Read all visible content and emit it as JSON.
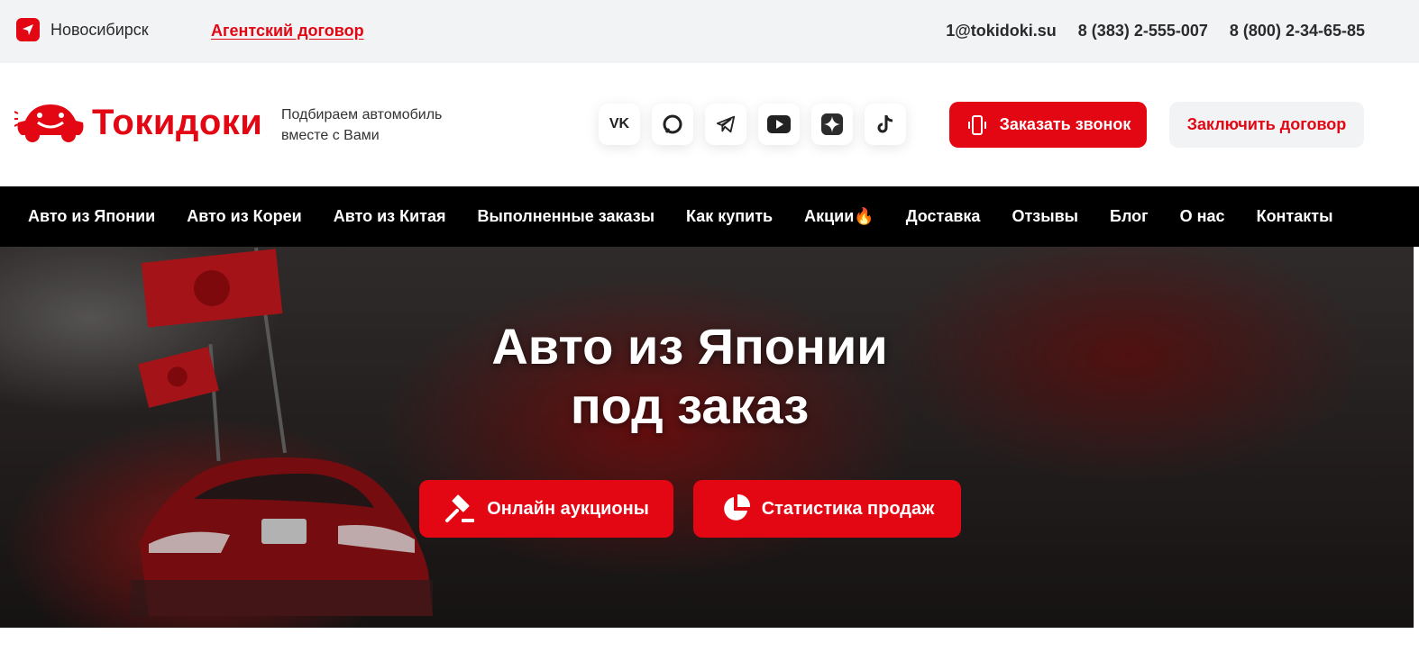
{
  "topbar": {
    "city": "Новосибирск",
    "agent_link": "Агентский договор",
    "email": "1@tokidoki.su",
    "phone_local": "8 (383) 2-555-007",
    "phone_free": "8 (800) 2-34-65-85"
  },
  "header": {
    "logo": "Токидоки",
    "tagline_line1": "Подбираем автомобиль",
    "tagline_line2": "вместе с Вами",
    "socials": [
      {
        "name": "vk-icon",
        "glyph": "VK"
      },
      {
        "name": "max-icon",
        "glyph": ""
      },
      {
        "name": "telegram-icon",
        "glyph": ""
      },
      {
        "name": "youtube-icon",
        "glyph": ""
      },
      {
        "name": "dzen-icon",
        "glyph": ""
      },
      {
        "name": "tiktok-icon",
        "glyph": ""
      }
    ],
    "call_button": "Заказать звонок",
    "contract_button": "Заключить договор"
  },
  "nav": {
    "items": [
      "Авто из Японии",
      "Авто из Кореи",
      "Авто из Китая",
      "Выполненные заказы",
      "Как купить",
      "Акции🔥",
      "Доставка",
      "Отзывы",
      "Блог",
      "О нас",
      "Контакты"
    ]
  },
  "hero": {
    "title_line1": "Авто из Японии",
    "title_line2": "под заказ",
    "auction_button": "Онлайн аукционы",
    "stats_button": "Статистика продаж"
  },
  "colors": {
    "accent": "#e30613",
    "topbar_bg": "#f2f3f5",
    "nav_bg": "#000000"
  }
}
